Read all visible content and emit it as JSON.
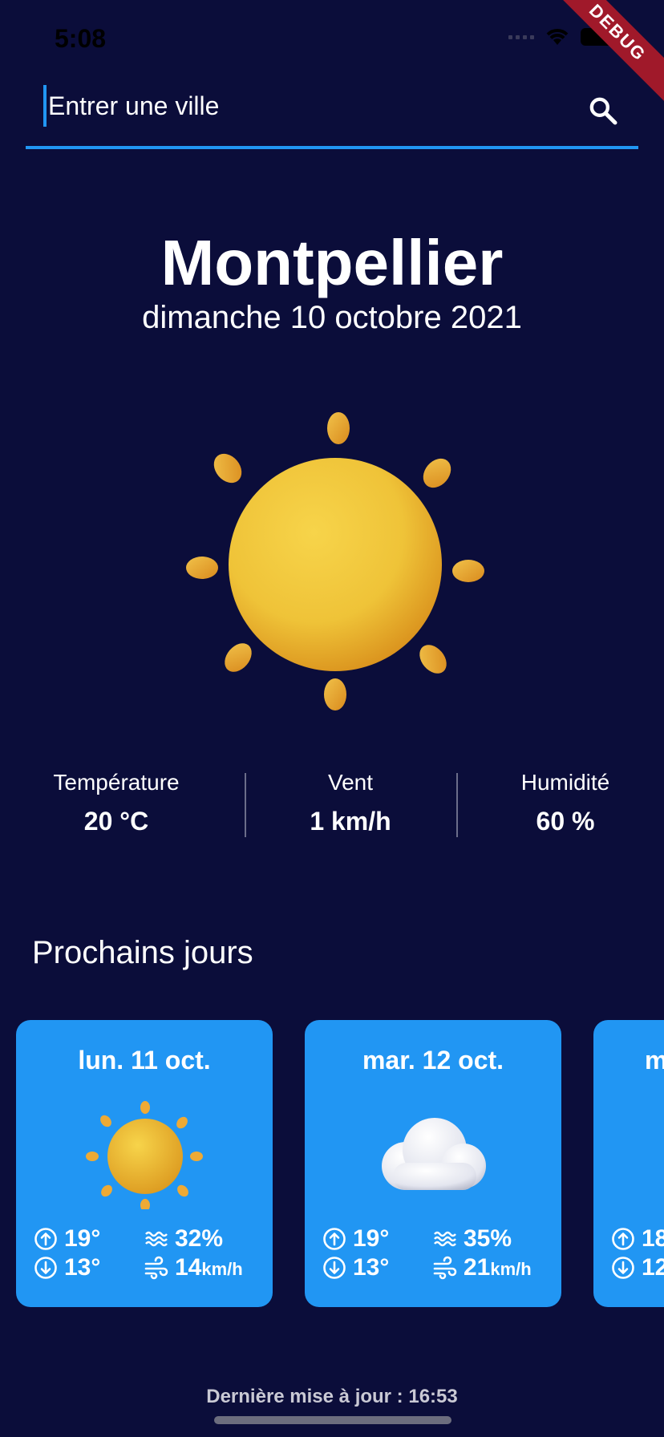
{
  "status": {
    "time": "5:08"
  },
  "debug": "DEBUG",
  "search": {
    "placeholder": "Entrer une ville"
  },
  "city": "Montpellier",
  "date": "dimanche 10 octobre 2021",
  "current_icon": "sun-icon",
  "stats": [
    {
      "label": "Température",
      "value": "20 °C"
    },
    {
      "label": "Vent",
      "value": "1 km/h"
    },
    {
      "label": "Humidité",
      "value": "60 %"
    }
  ],
  "section_title": "Prochains jours",
  "forecast": [
    {
      "day": "lun. 11 oct.",
      "icon": "sun-icon",
      "max": "19°",
      "min": "13°",
      "humidity": "32%",
      "wind": "14",
      "wind_unit": "km/h"
    },
    {
      "day": "mar. 12 oct.",
      "icon": "cloud-icon",
      "max": "19°",
      "min": "13°",
      "humidity": "35%",
      "wind": "21",
      "wind_unit": "km/h"
    },
    {
      "day": "m",
      "max": "18",
      "min": "12"
    }
  ],
  "last_update": "Dernière mise à jour : 16:53",
  "colors": {
    "background": "#0b0d3a",
    "accent": "#2196f3",
    "debug": "#a0192a"
  }
}
